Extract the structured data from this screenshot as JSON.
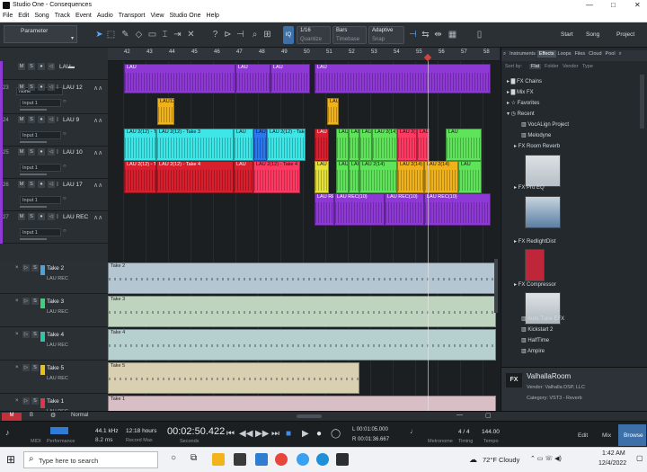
{
  "window": {
    "title": "Studio One - Consequences",
    "controls": [
      "—",
      "□",
      "✕"
    ]
  },
  "menu": [
    "File",
    "Edit",
    "Song",
    "Track",
    "Event",
    "Audio",
    "Transport",
    "View",
    "Studio One",
    "Help"
  ],
  "toolbar": {
    "parameter_label": "Parameter",
    "quantize_value": "1/16",
    "quantize_label": "Quantize",
    "timebase_value": "Bars",
    "timebase_label": "Timebase",
    "snap_value": "Adaptive",
    "snap_label": "Snap",
    "iq": "IQ",
    "start": "Start",
    "song": "Song",
    "project": "Project"
  },
  "ruler": [
    "42",
    "43",
    "44",
    "45",
    "46",
    "47",
    "48",
    "49",
    "50",
    "51",
    "52",
    "53",
    "54",
    "55",
    "56",
    "57",
    "58"
  ],
  "tracks": [
    {
      "num": "",
      "name": "LAU",
      "input": "None",
      "clips": [
        "LAU",
        "LAU",
        "LAU",
        "LAU"
      ]
    },
    {
      "num": "23",
      "name": "LAU 12",
      "input": "Input 1",
      "clips": [
        "LAU12",
        "LAU"
      ]
    },
    {
      "num": "24",
      "name": "LAU 9",
      "input": "Input 1",
      "clips": [
        "LAU 2(12) - Take",
        "LAU 2(12) - Take 3",
        "LAU",
        "LAU 2(12)",
        "LAU 2(12) - Take 3",
        "LAU",
        "LAU 2(14)",
        "LAU 2(14)",
        "LAU 2(14)",
        "LAU 2(14)",
        "LAU 2(14",
        "LAU 2(1",
        "LAU"
      ]
    },
    {
      "num": "25",
      "name": "LAU 10",
      "input": "Input 1",
      "clips": [
        "LAU 2(12) - Take",
        "LAU 2(12) - Take 4",
        "LAU",
        "LAU 2(12) - Take 4",
        "LAU 2(",
        "LAU 2(14)",
        "LAU 2(14)",
        "LAU 2(14)",
        "LAU 2(14)",
        "LAU 2(14)",
        "LAU"
      ]
    },
    {
      "num": "26",
      "name": "LAU 17",
      "input": "Input 1",
      "clips": [
        "LAU REC(10)",
        "LAU REC(10)",
        "LAU REC(10)",
        "LAU REC(10)"
      ]
    },
    {
      "num": "27",
      "name": "LAU REC",
      "input": "Input 1",
      "clips": []
    }
  ],
  "layers": [
    {
      "name": "Take 2",
      "sub": "LAU REC",
      "clip": "Take 2",
      "color": "#4aa3df",
      "fill": "#b3c6d2"
    },
    {
      "name": "Take 3",
      "sub": "LAU REC",
      "clip": "Take 3",
      "color": "#3fcf7a",
      "fill": "#bfd4bf"
    },
    {
      "name": "Take 4",
      "sub": "LAU REC",
      "clip": "Take 4",
      "color": "#2ec4a8",
      "fill": "#b6d0cf"
    },
    {
      "name": "Take 5",
      "sub": "LAU REC",
      "clip": "Take 5",
      "color": "#e8c21a",
      "fill": "#d8d0b0"
    },
    {
      "name": "Take 1",
      "sub": "LAU REC",
      "clip": "Take 1",
      "color": "#e0344a",
      "fill": "#d8bfc6"
    }
  ],
  "bottom": {
    "m": "M",
    "b": "B",
    "normal": "Normal"
  },
  "browser": {
    "tabs": [
      "Instruments",
      "Effects",
      "Loops",
      "Files",
      "Cloud",
      "Pool"
    ],
    "active_tab": "Effects",
    "sort": [
      "Sort by:",
      "Flat",
      "Folder",
      "Vendor",
      "Type"
    ],
    "folders": [
      "FX Chains",
      "Mix FX",
      "Favorites",
      "Recent"
    ],
    "recent": [
      "VocALign Project",
      "Melodyne",
      "Room Reverb",
      "Pro EQ",
      "RedlightDist",
      "Compressor",
      "Auto-Tune EFX",
      "Kickstart 2",
      "HalfTime",
      "Ampire"
    ],
    "info": {
      "badge": "FX",
      "name": "ValhallaRoom",
      "vendor": "Vendor:  Valhalla DSP, LLC",
      "category": "Category:  VST3 - Reverb"
    }
  },
  "transport": {
    "midi": "MIDI",
    "performance": "Performance",
    "rate": "44.1 kHz",
    "latency": "8.2 ms",
    "rec_time": "12:18 hours",
    "rec_max": "Record Max",
    "time": "00:02:50.422",
    "seconds": "Seconds",
    "l_time": "L  00:01:05.000",
    "r_time": "R  00:01:36.667",
    "metronome": "Metronome",
    "timing": "4 / 4",
    "timing_label": "Timing",
    "tempo": "144.00",
    "tempo_label": "Tempo",
    "edit": "Edit",
    "mix": "Mix",
    "browse": "Browse"
  },
  "taskbar": {
    "search": "Type here to search",
    "weather": "72°F  Cloudy",
    "time": "1:42 AM",
    "date": "12/4/2022"
  },
  "colors": {
    "purple": "#8e39d6",
    "orange": "#f0b21c",
    "cyan": "#3ee6e8",
    "green": "#5fe35a",
    "red": "#d81f2e",
    "pink": "#ff3a62",
    "yellow": "#e6e13a",
    "blue": "#2a78f0"
  }
}
